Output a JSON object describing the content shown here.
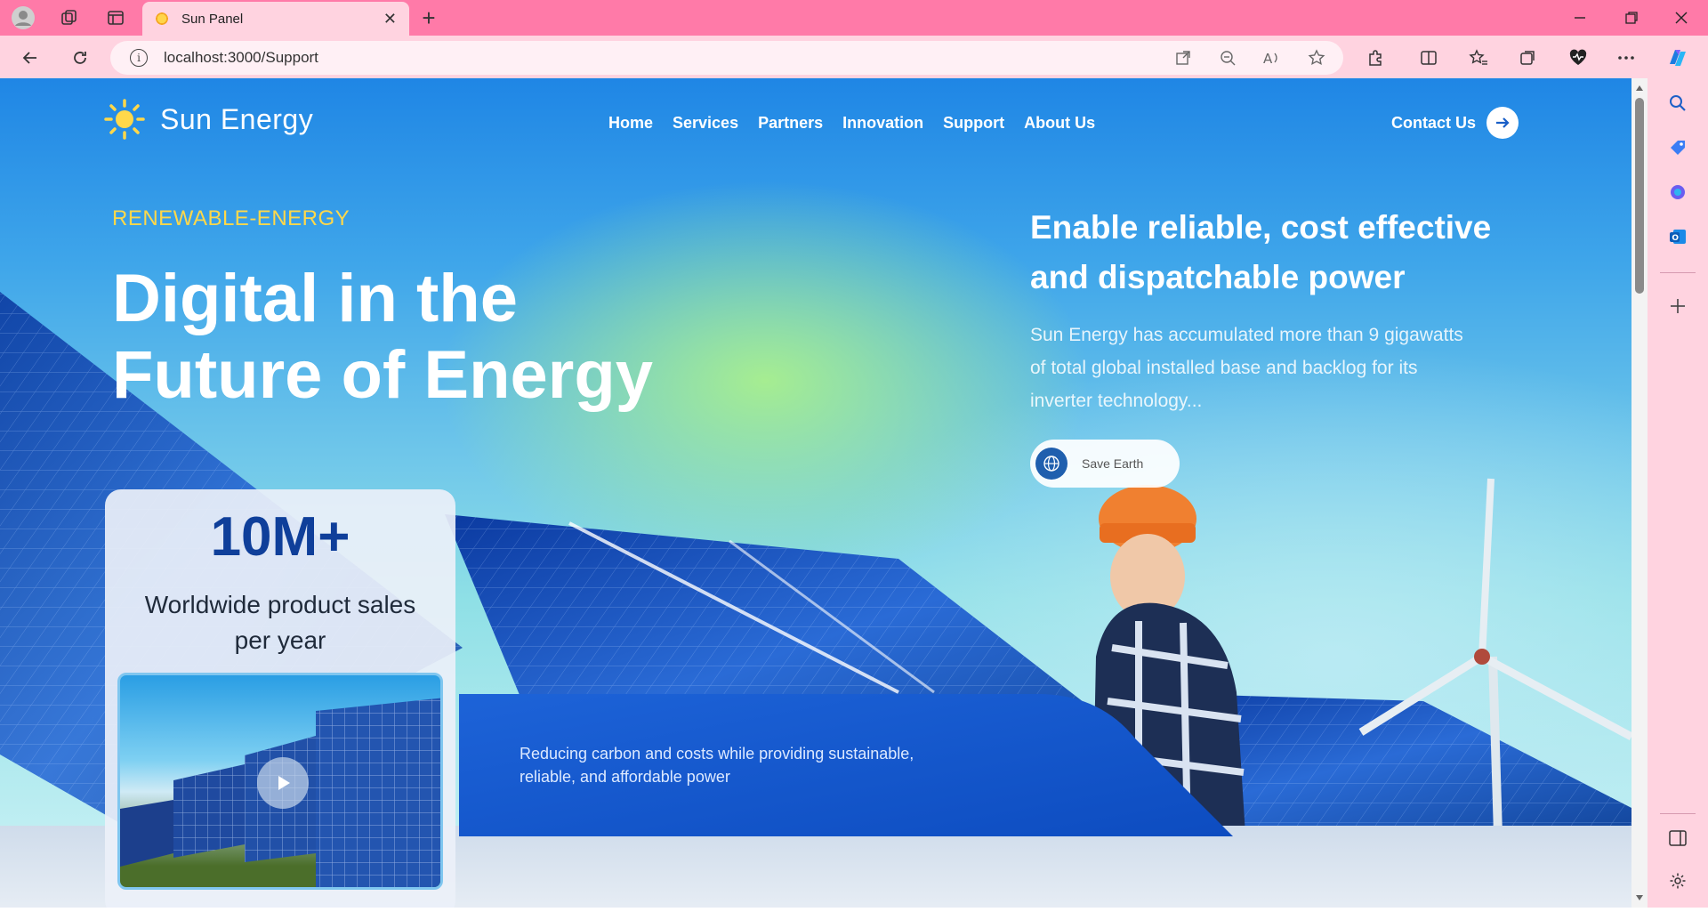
{
  "browser": {
    "tab_title": "Sun Panel",
    "url": "localhost:3000/Support",
    "new_tab_symbol": "+",
    "close_symbol": "✕"
  },
  "site": {
    "brand": "Sun Energy",
    "nav": [
      "Home",
      "Services",
      "Partners",
      "Innovation",
      "Support",
      "About Us"
    ],
    "contact_label": "Contact Us"
  },
  "hero": {
    "eyebrow": "RENEWABLE-ENERGY",
    "headline": "Digital in the Future of Energy",
    "subheadline": "Enable reliable, cost effective and dispatchable power",
    "description": "Sun Energy has accumulated more than 9 gigawatts of total global installed base and backlog for its inverter technology...",
    "save_label": "Save Earth"
  },
  "stat_card": {
    "number": "10M+",
    "label": "Worldwide product sales per year"
  },
  "banner": {
    "text": "Reducing carbon and costs while providing sustainable, reliable, and affordable power"
  },
  "colors": {
    "accent_yellow": "#ffd84a",
    "brand_blue": "#0f3f9a",
    "chrome_pink": "#ff7aa8"
  },
  "icons": {
    "play": "play-icon",
    "globe": "globe-icon",
    "arrow": "arrow-right-icon",
    "sun": "sun-icon"
  }
}
